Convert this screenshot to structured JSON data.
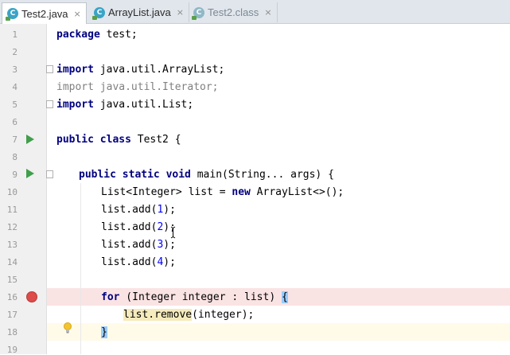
{
  "tabs": [
    {
      "label": "Test2.java",
      "active": true
    },
    {
      "label": "ArrayList.java",
      "active": false
    },
    {
      "label": "Test2.class",
      "active": false
    }
  ],
  "tab_close_glyph": "×",
  "class_icon_letter": "C",
  "line_numbers": [
    "1",
    "2",
    "3",
    "4",
    "5",
    "6",
    "7",
    "8",
    "9",
    "10",
    "11",
    "12",
    "13",
    "14",
    "15",
    "16",
    "17",
    "18",
    "19"
  ],
  "code": {
    "l1": {
      "kw": "package",
      "rest": " test;"
    },
    "l3": {
      "kw": "import",
      "rest": " java.util.ArrayList;"
    },
    "l4": {
      "kw": "import",
      "rest": " java.util.Iterator;"
    },
    "l5": {
      "kw": "import",
      "rest": " java.util.List;"
    },
    "l7": {
      "kw": "public class",
      "rest": " Test2 {"
    },
    "l9": {
      "kw": "public static void",
      "rest": " main(String... args) {"
    },
    "l10": {
      "pre": "List<Integer> list = ",
      "kw": "new",
      "rest": " ArrayList<>();"
    },
    "l11": {
      "pre": "list.add(",
      "num": "1",
      "post": ");"
    },
    "l12": {
      "pre": "list.add(",
      "num": "2",
      "post": ");"
    },
    "l13": {
      "pre": "list.add(",
      "num": "3",
      "post": ");"
    },
    "l14": {
      "pre": "list.add(",
      "num": "4",
      "post": ");"
    },
    "l16": {
      "kw": "for",
      "rest": " (Integer integer : list) ",
      "brace": "{"
    },
    "l17": {
      "hl": "list.remove",
      "rest": "(integer);"
    },
    "l18": {
      "brace": "}"
    }
  },
  "colors": {
    "keyword": "#000080",
    "number": "#0000ff",
    "unused_import": "#808080",
    "breakpoint": "#de4b4b",
    "run_icon": "#3f9f4b",
    "brace_match": "#99ccff",
    "breakpoint_line": "#fae3e3",
    "warning_highlight": "#f6ebbc"
  },
  "icons": {
    "run": "run-icon",
    "breakpoint": "breakpoint-icon",
    "intention": "lightbulb-icon",
    "fold": "fold-icon",
    "class": "java-class-icon"
  }
}
